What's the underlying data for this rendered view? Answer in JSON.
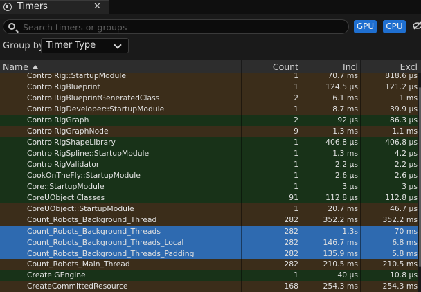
{
  "tab": {
    "title": "Timers",
    "close_glyph": "✕",
    "icon": "timer-icon"
  },
  "toolbar": {
    "search_placeholder": "Search timers or groups",
    "gpu_label": "GPU",
    "cpu_label": "CPU",
    "groupby_label": "Group by",
    "groupby_value": "Timer Type"
  },
  "colors": {
    "accent": "#1f6fd0",
    "row_brown": "#3b2d1a",
    "row_green": "#183218",
    "row_selected": "#2e6ab0"
  },
  "table": {
    "columns": {
      "name": "Name",
      "count": "Count",
      "incl": "Incl",
      "excl": "Excl"
    },
    "sort": {
      "column": "name",
      "direction": "ascending"
    },
    "rows": [
      {
        "name": "ControlRig::StartupModule",
        "count": "1",
        "incl": "70.7 ms",
        "excl": "818.6 μs",
        "color": "brown",
        "selected": false
      },
      {
        "name": "ControlRigBlueprint",
        "count": "1",
        "incl": "124.5 μs",
        "excl": "121.2 μs",
        "color": "brown",
        "selected": false
      },
      {
        "name": "ControlRigBlueprintGeneratedClass",
        "count": "2",
        "incl": "6.1 ms",
        "excl": "1 ms",
        "color": "brown",
        "selected": false
      },
      {
        "name": "ControlRigDeveloper::StartupModule",
        "count": "1",
        "incl": "8.7 ms",
        "excl": "39.9 μs",
        "color": "brown",
        "selected": false
      },
      {
        "name": "ControlRigGraph",
        "count": "2",
        "incl": "92 μs",
        "excl": "86.3 μs",
        "color": "green",
        "selected": false
      },
      {
        "name": "ControlRigGraphNode",
        "count": "9",
        "incl": "1.3 ms",
        "excl": "1.1 ms",
        "color": "brown",
        "selected": false
      },
      {
        "name": "ControlRigShapeLibrary",
        "count": "1",
        "incl": "406.8 μs",
        "excl": "406.8 μs",
        "color": "green",
        "selected": false
      },
      {
        "name": "ControlRigSpline::StartupModule",
        "count": "1",
        "incl": "1.3 ms",
        "excl": "4.2 μs",
        "color": "green",
        "selected": false
      },
      {
        "name": "ControlRigValidator",
        "count": "1",
        "incl": "2.2 μs",
        "excl": "2.2 μs",
        "color": "green",
        "selected": false
      },
      {
        "name": "CookOnTheFly::StartupModule",
        "count": "1",
        "incl": "2.6 μs",
        "excl": "2.6 μs",
        "color": "green",
        "selected": false
      },
      {
        "name": "Core::StartupModule",
        "count": "1",
        "incl": "3 μs",
        "excl": "3 μs",
        "color": "green",
        "selected": false
      },
      {
        "name": "CoreUObject Classes",
        "count": "91",
        "incl": "112.8 μs",
        "excl": "112.8 μs",
        "color": "green",
        "selected": false
      },
      {
        "name": "CoreUObject::StartupModule",
        "count": "1",
        "incl": "20.7 ms",
        "excl": "46.7 μs",
        "color": "brown",
        "selected": false
      },
      {
        "name": "Count_Robots_Background_Thread",
        "count": "282",
        "incl": "352.2 ms",
        "excl": "352.2 ms",
        "color": "brown",
        "selected": false
      },
      {
        "name": "Count_Robots_Background_Threads",
        "count": "282",
        "incl": "1.3s",
        "excl": "70 ms",
        "color": "brown",
        "selected": true
      },
      {
        "name": "Count_Robots_Background_Threads_Local",
        "count": "282",
        "incl": "146.7 ms",
        "excl": "6.8 ms",
        "color": "brown",
        "selected": true
      },
      {
        "name": "Count_Robots_Background_Threads_Padding",
        "count": "282",
        "incl": "135.9 ms",
        "excl": "5.8 ms",
        "color": "brown",
        "selected": true
      },
      {
        "name": "Count_Robots_Main_Thread",
        "count": "282",
        "incl": "210.5 ms",
        "excl": "210.5 ms",
        "color": "brown",
        "selected": false
      },
      {
        "name": "Create GEngine",
        "count": "1",
        "incl": "40 μs",
        "excl": "10.8 μs",
        "color": "green",
        "selected": false
      },
      {
        "name": "CreateCommittedResource",
        "count": "168",
        "incl": "254.3 ms",
        "excl": "254.3 ms",
        "color": "brown",
        "selected": false
      }
    ]
  }
}
